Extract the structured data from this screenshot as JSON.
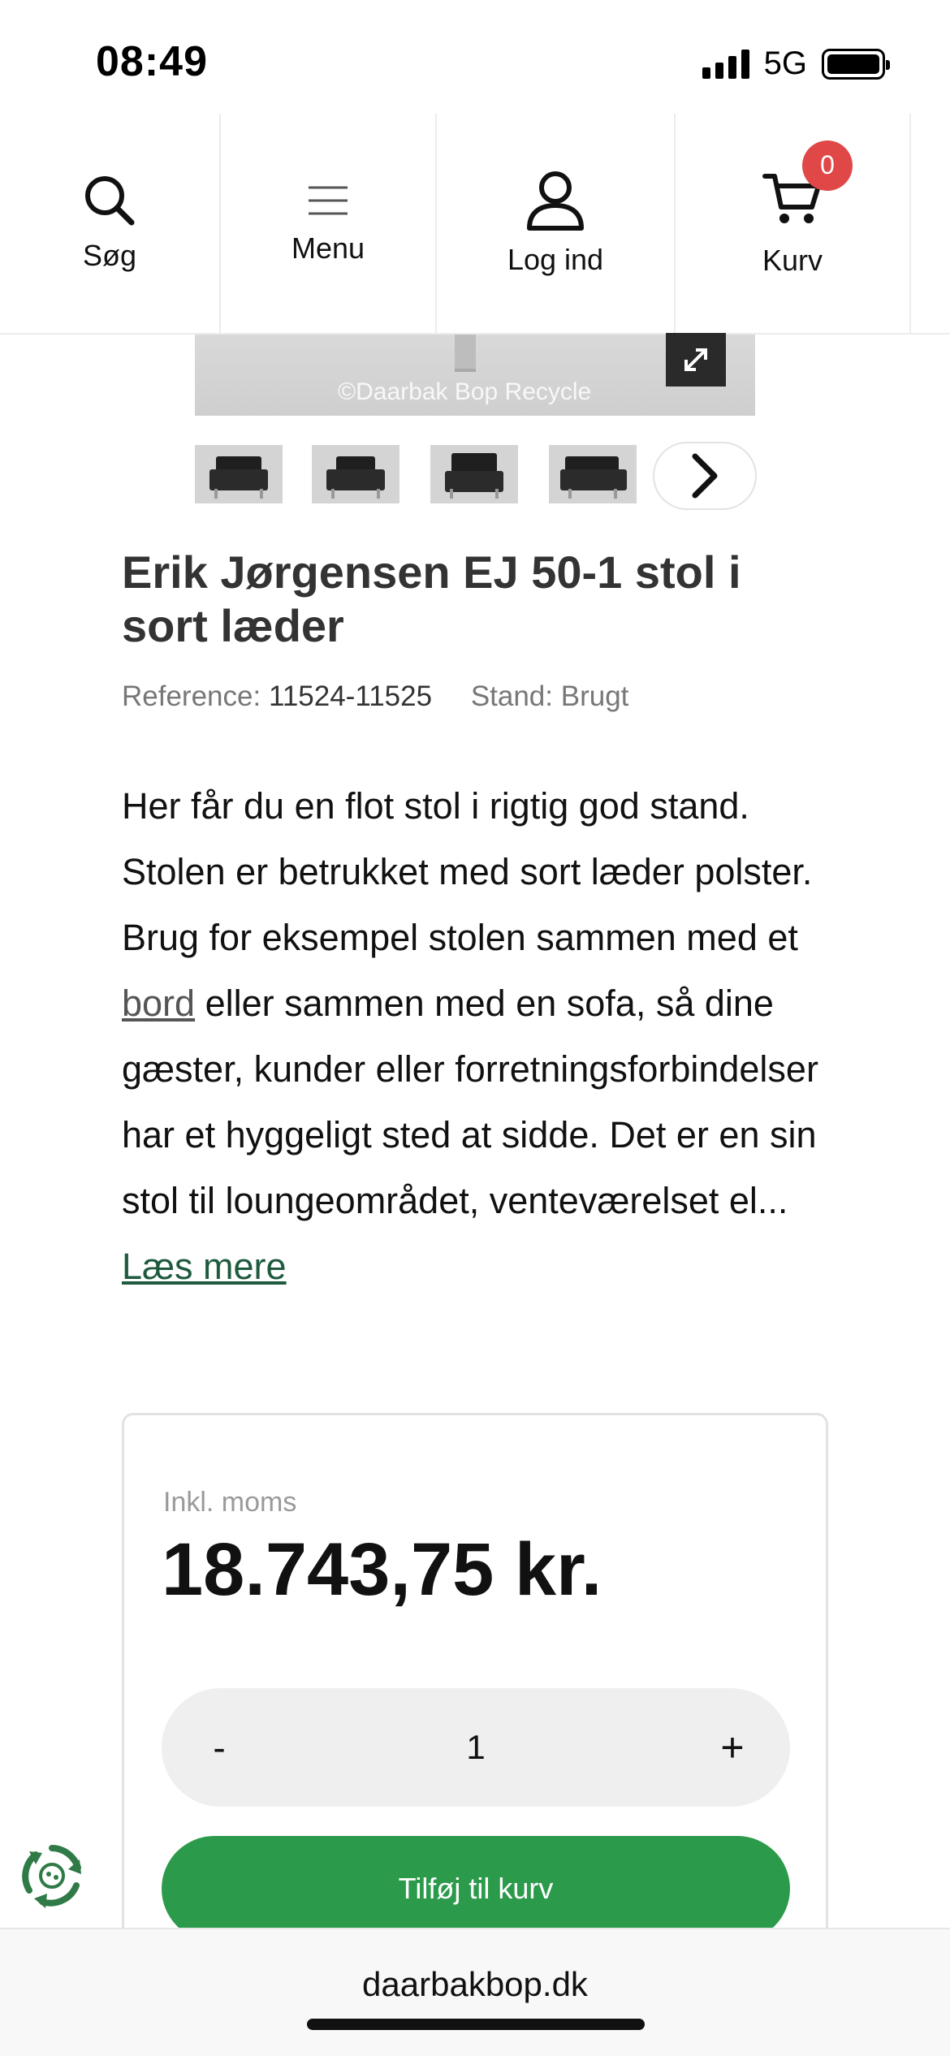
{
  "status_bar": {
    "time": "08:49",
    "network": "5G"
  },
  "nav": {
    "search_label": "Søg",
    "menu_label": "Menu",
    "login_label": "Log ind",
    "cart_label": "Kurv",
    "cart_count": "0"
  },
  "gallery": {
    "watermark": "©Daarbak Bop Recycle",
    "thumbnail_count": 4
  },
  "product": {
    "title": "Erik Jørgensen EJ 50-1 stol i sort læder",
    "reference_label": "Reference:",
    "reference_value": "11524-11525",
    "stand": "Stand: Brugt",
    "description_part1": "Her får du en flot stol i rigtig god stand. Stolen er betrukket med sort læder polster. Brug for eksempel stolen sammen med et ",
    "description_link": "bord",
    "description_part2": " eller sammen med en sofa, så dine gæster, kunder eller forretningsforbindelser har et hyggeligt sted at sidde. Det er en sin stol til loungeområdet, venteværelset el... ",
    "read_more": "Læs mere"
  },
  "purchase": {
    "vat_label": "Inkl. moms",
    "price": "18.743,75 kr.",
    "qty_minus": "-",
    "qty_value": "1",
    "qty_plus": "+",
    "add_to_cart": "Tilføj til kurv"
  },
  "browser": {
    "url": "daarbakbop.dk"
  },
  "colors": {
    "accent_green": "#2c9a4b",
    "badge_red": "#e04747",
    "link_green": "#1e5a3e"
  }
}
